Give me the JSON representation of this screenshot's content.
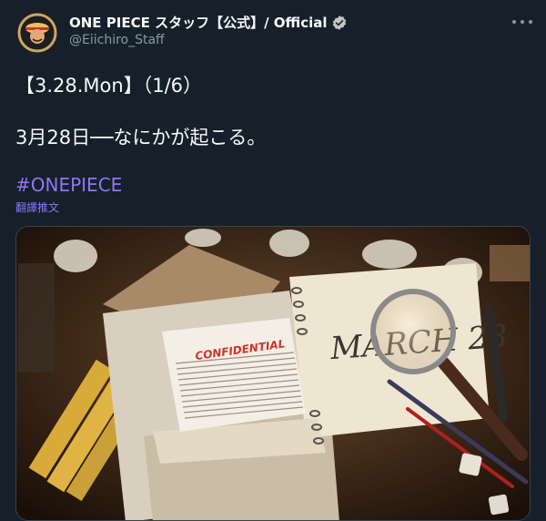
{
  "author": {
    "display_name": "ONE PIECE スタッフ【公式】/ Official",
    "handle": "@Eiichiro_Staff",
    "avatar_icon": "avatar-luffy",
    "verified_icon": "verified-badge-icon"
  },
  "tweet": {
    "line1": "【3.28.Mon】（1/6）",
    "line2": "3月28日──なにかが起こる。",
    "hashtag": "#ONEPIECE",
    "translate": "翻譯推文"
  },
  "media": {
    "confidential_text": "CONFIDENTIAL",
    "handwriting_text": "MARCH 28"
  },
  "colors": {
    "background": "#15202b",
    "text": "#f7f9f9",
    "secondary": "#8b98a5",
    "link": "#8f75f5",
    "confidential": "#d0342c"
  }
}
